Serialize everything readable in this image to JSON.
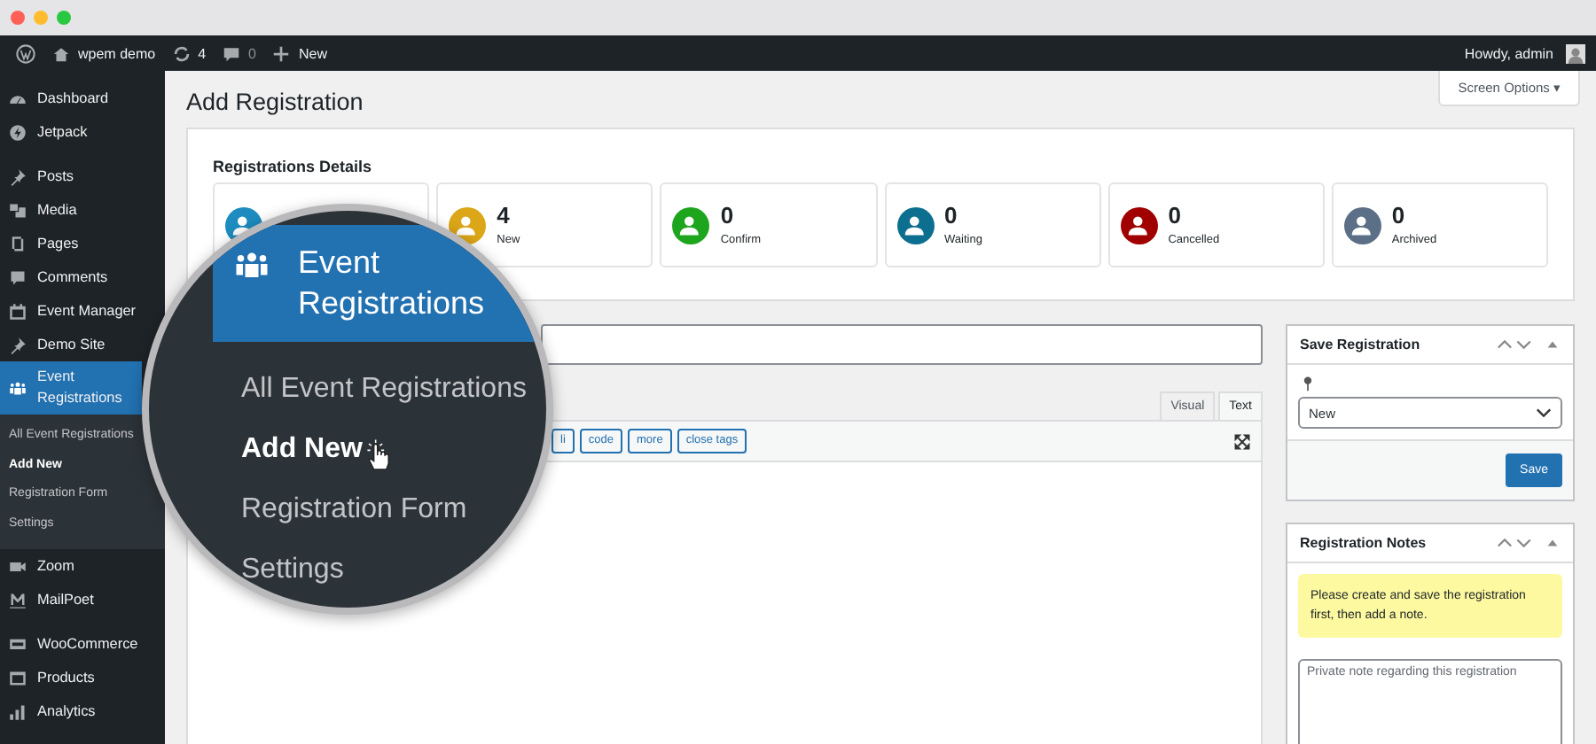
{
  "admin_bar": {
    "site": "wpem demo",
    "updates": "4",
    "comments": "0",
    "new": "New",
    "greeting": "Howdy, admin"
  },
  "sidebar": {
    "items": [
      {
        "label": "Dashboard",
        "selected": false,
        "group_start": false
      },
      {
        "label": "Jetpack",
        "selected": false,
        "group_start": false
      },
      {
        "label": "Posts",
        "selected": false,
        "group_start": true
      },
      {
        "label": "Media",
        "selected": false,
        "group_start": false
      },
      {
        "label": "Pages",
        "selected": false,
        "group_start": false
      },
      {
        "label": "Comments",
        "selected": false,
        "group_start": false
      },
      {
        "label": "Event Manager",
        "selected": false,
        "group_start": false
      },
      {
        "label": "Demo Site",
        "selected": false,
        "group_start": false
      },
      {
        "label": "Event Registrations",
        "selected": true,
        "group_start": false,
        "children": [
          {
            "label": "All Event Registrations",
            "selected": false
          },
          {
            "label": "Add New",
            "selected": true
          },
          {
            "label": "Registration Form",
            "selected": false
          },
          {
            "label": "Settings",
            "selected": false
          }
        ]
      },
      {
        "label": "Zoom",
        "selected": false,
        "group_start": false
      },
      {
        "label": "MailPoet",
        "selected": false,
        "group_start": false
      },
      {
        "label": "WooCommerce",
        "selected": false,
        "group_start": true
      },
      {
        "label": "Products",
        "selected": false,
        "group_start": false
      },
      {
        "label": "Analytics",
        "selected": false,
        "group_start": false
      }
    ]
  },
  "page": {
    "title": "Add Registration",
    "screen_options": "Screen Options ▾"
  },
  "details": {
    "title": "Registrations Details",
    "stats": [
      {
        "color": "#1e8cbe"
      },
      {
        "value": "4",
        "label": "New",
        "color": "#dba617"
      },
      {
        "value": "0",
        "label": "Confirm",
        "color": "#1ea51e"
      },
      {
        "value": "0",
        "label": "Waiting",
        "color": "#0d6f8f"
      },
      {
        "value": "0",
        "label": "Cancelled",
        "color": "#a00000"
      },
      {
        "value": "0",
        "label": "Archived",
        "color": "#5b6f87"
      }
    ]
  },
  "editor": {
    "tabs": [
      {
        "label": "Visual",
        "selected": false
      },
      {
        "label": "Text",
        "selected": true
      }
    ],
    "quicktags": [
      "li",
      "code",
      "more",
      "close tags"
    ]
  },
  "save_box": {
    "title": "Save Registration",
    "status": "New",
    "button": "Save"
  },
  "notes_box": {
    "title": "Registration Notes",
    "notice": "Please create and save the registration first, then add a note.",
    "placeholder": "Private note regarding this registration"
  },
  "magnifier": {
    "heading": "Event Registrations",
    "items": [
      {
        "label": "All Event Registrations",
        "selected": false
      },
      {
        "label": "Add New",
        "selected": true
      },
      {
        "label": "Registration Form",
        "selected": false
      },
      {
        "label": "Settings",
        "selected": false
      }
    ]
  }
}
